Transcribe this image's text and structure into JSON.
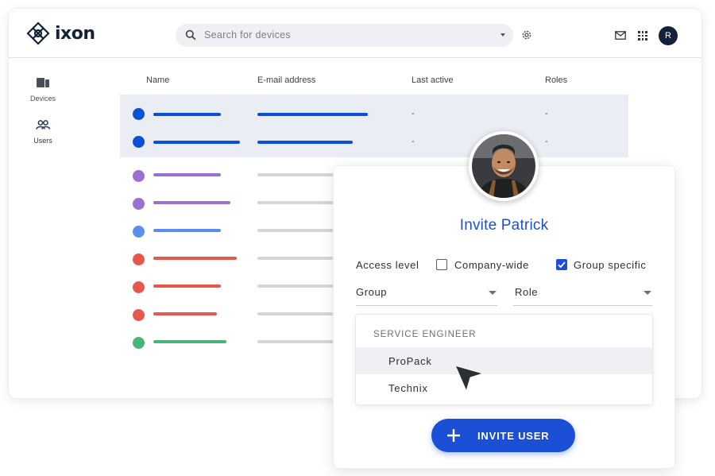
{
  "app": {
    "brand": "ixon",
    "brand_color": "#14213d",
    "accent_color": "#1a4fd6"
  },
  "header": {
    "search_placeholder": "Search for devices",
    "avatar_initial": "R",
    "icons": [
      "search-icon",
      "chevron-down-icon",
      "gear-icon",
      "mail-icon",
      "apps-grid-icon"
    ]
  },
  "sidebar": {
    "items": [
      {
        "label": "Devices",
        "icon": "devices-icon",
        "active": false
      },
      {
        "label": "Users",
        "icon": "users-icon",
        "active": true
      }
    ]
  },
  "table": {
    "columns": [
      "Name",
      "E-mail address",
      "Last active",
      "Roles"
    ],
    "rows": [
      {
        "color": "#0a4fd8",
        "selected": true,
        "last_active": "-",
        "roles": "-"
      },
      {
        "color": "#0a4fd8",
        "selected": true,
        "last_active": "-",
        "roles": "-"
      },
      {
        "color": "#9c6fd2",
        "selected": false
      },
      {
        "color": "#9c6fd2",
        "selected": false
      },
      {
        "color": "#5a8ff0",
        "selected": false
      },
      {
        "color": "#e5584b",
        "selected": false
      },
      {
        "color": "#e5584b",
        "selected": false
      },
      {
        "color": "#e5584b",
        "selected": false
      },
      {
        "color": "#48b37a",
        "selected": false
      }
    ]
  },
  "invite": {
    "title": "Invite Patrick",
    "access_level_label": "Access level",
    "options": [
      {
        "label": "Company-wide",
        "checked": false
      },
      {
        "label": "Group specific",
        "checked": true
      }
    ],
    "group_label": "Group",
    "role_label": "Role",
    "dropdown": {
      "heading": "SERVICE ENGINEER",
      "items": [
        "ProPack",
        "Technix"
      ],
      "highlighted": "ProPack"
    },
    "button_label": "INVITE USER"
  }
}
